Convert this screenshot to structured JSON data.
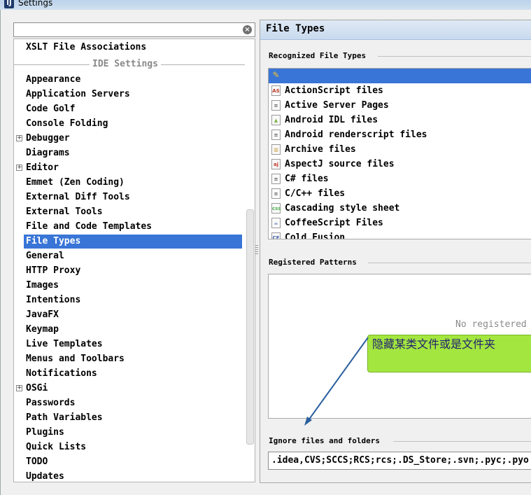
{
  "window": {
    "title": "Settings",
    "app_icon": "ij-icon"
  },
  "search": {
    "value": "",
    "placeholder": ""
  },
  "tree": {
    "top_item": "XSLT File Associations",
    "section_label": "IDE Settings",
    "items": [
      {
        "label": "Appearance",
        "expandable": false
      },
      {
        "label": "Application Servers",
        "expandable": false
      },
      {
        "label": "Code Golf",
        "expandable": false
      },
      {
        "label": "Console Folding",
        "expandable": false
      },
      {
        "label": "Debugger",
        "expandable": true
      },
      {
        "label": "Diagrams",
        "expandable": false
      },
      {
        "label": "Editor",
        "expandable": true
      },
      {
        "label": "Emmet (Zen Coding)",
        "expandable": false
      },
      {
        "label": "External Diff Tools",
        "expandable": false
      },
      {
        "label": "External Tools",
        "expandable": false
      },
      {
        "label": "File and Code Templates",
        "expandable": false
      },
      {
        "label": "File Types",
        "expandable": false,
        "selected": true
      },
      {
        "label": "General",
        "expandable": false
      },
      {
        "label": "HTTP Proxy",
        "expandable": false
      },
      {
        "label": "Images",
        "expandable": false
      },
      {
        "label": "Intentions",
        "expandable": false
      },
      {
        "label": "JavaFX",
        "expandable": false
      },
      {
        "label": "Keymap",
        "expandable": false
      },
      {
        "label": "Live Templates",
        "expandable": false
      },
      {
        "label": "Menus and Toolbars",
        "expandable": false
      },
      {
        "label": "Notifications",
        "expandable": false
      },
      {
        "label": "OSGi",
        "expandable": true
      },
      {
        "label": "Passwords",
        "expandable": false
      },
      {
        "label": "Path Variables",
        "expandable": false
      },
      {
        "label": "Plugins",
        "expandable": false
      },
      {
        "label": "Quick Lists",
        "expandable": false
      },
      {
        "label": "TODO",
        "expandable": false
      },
      {
        "label": "Updates",
        "expandable": false
      }
    ]
  },
  "panel": {
    "title": "File Types",
    "recognized_label": "Recognized File Types",
    "file_types": [
      {
        "label": "ActionScript files",
        "icon": "actionscript-icon",
        "glyph": "AS",
        "color": "#c0392b"
      },
      {
        "label": "Active Server Pages",
        "icon": "asp-file-icon",
        "glyph": "≡",
        "color": "#555555"
      },
      {
        "label": "Android IDL files",
        "icon": "android-icon",
        "glyph": "▲",
        "color": "#7cb342"
      },
      {
        "label": "Android renderscript files",
        "icon": "text-file-icon",
        "glyph": "≡",
        "color": "#555555"
      },
      {
        "label": "Archive files",
        "icon": "archive-icon",
        "glyph": "▥",
        "color": "#c79a3a"
      },
      {
        "label": "AspectJ source files",
        "icon": "aspectj-icon",
        "glyph": "aj",
        "color": "#c0392b"
      },
      {
        "label": "C# files",
        "icon": "csharp-file-icon",
        "glyph": "≡",
        "color": "#555555"
      },
      {
        "label": "C/C++ files",
        "icon": "cpp-file-icon",
        "glyph": "≡",
        "color": "#555555"
      },
      {
        "label": "Cascading style sheet",
        "icon": "css-icon",
        "glyph": "css",
        "color": "#4caf50"
      },
      {
        "label": "CoffeeScript Files",
        "icon": "coffeescript-icon",
        "glyph": "☕",
        "color": "#3a5ea8"
      },
      {
        "label": "Cold Fusion",
        "icon": "coldfusion-icon",
        "glyph": "CF",
        "color": "#3a5ea8"
      }
    ],
    "patterns_label": "Registered Patterns",
    "no_patterns_text": "No registered",
    "ignore_label": "Ignore files and folders",
    "ignore_value": ".idea,CVS;SCCS;RCS;rcs;.DS_Store;.svn;.pyc;.pyo"
  },
  "callout": {
    "text": "隐藏某类文件或是文件夹"
  },
  "colors": {
    "selection": "#3875d7",
    "callout": "#a3e63f",
    "arrow": "#2b5f9e"
  }
}
